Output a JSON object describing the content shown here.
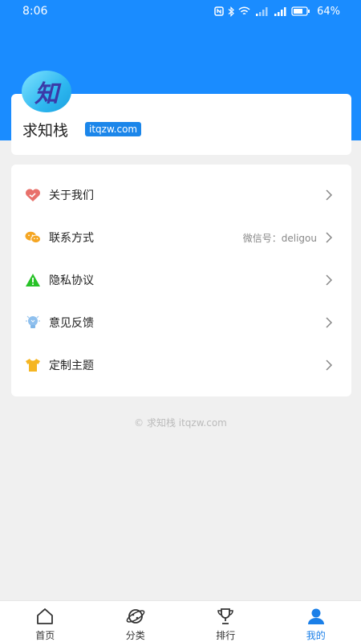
{
  "status_bar": {
    "time": "8:06",
    "battery": "64%"
  },
  "profile": {
    "avatar_char": "知",
    "name": "求知栈",
    "badge": "itqzw.com"
  },
  "menu": {
    "items": [
      {
        "label": "关于我们",
        "value": "",
        "icon": "heart-handshake-icon",
        "color": "#e8716b"
      },
      {
        "label": "联系方式",
        "value": "微信号：deligou",
        "icon": "wechat-icon",
        "color": "#f5a623"
      },
      {
        "label": "隐私协议",
        "value": "",
        "icon": "warning-icon",
        "color": "#27c227"
      },
      {
        "label": "意见反馈",
        "value": "",
        "icon": "lightbulb-icon",
        "color": "#7fb6e8"
      },
      {
        "label": "定制主题",
        "value": "",
        "icon": "tshirt-icon",
        "color": "#f5b623"
      }
    ]
  },
  "footer": {
    "copyright": "© 求知栈 itqzw.com"
  },
  "tabs": [
    {
      "label": "首页",
      "icon": "home-icon",
      "active": false
    },
    {
      "label": "分类",
      "icon": "planet-icon",
      "active": false
    },
    {
      "label": "排行",
      "icon": "trophy-icon",
      "active": false
    },
    {
      "label": "我的",
      "icon": "user-icon",
      "active": true
    }
  ],
  "colors": {
    "primary": "#1a8cff",
    "active_tab": "#1a7fe8",
    "background": "#f0f0f0"
  }
}
